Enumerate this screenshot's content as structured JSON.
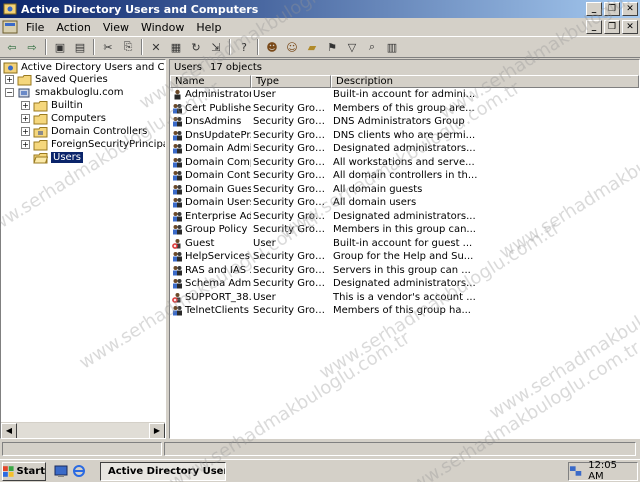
{
  "window": {
    "title": "Active Directory Users and Computers"
  },
  "menu": [
    "File",
    "Action",
    "View",
    "Window",
    "Help"
  ],
  "tree": {
    "root": "Active Directory Users and Computers",
    "saved_queries": "Saved Queries",
    "domain": "smakbuloglu.com",
    "children": [
      "Builtin",
      "Computers",
      "Domain Controllers",
      "ForeignSecurityPrincipals",
      "Users"
    ]
  },
  "pane": {
    "title": "Users",
    "count": "17 objects"
  },
  "columns": [
    "Name",
    "Type",
    "Description"
  ],
  "rows": [
    {
      "name": "Administrator",
      "type": "User",
      "desc": "Built-in account for admini...",
      "kind": "user"
    },
    {
      "name": "Cert Publishers",
      "type": "Security Group ...",
      "desc": "Members of this group are...",
      "kind": "group"
    },
    {
      "name": "DnsAdmins",
      "type": "Security Group ...",
      "desc": "DNS Administrators Group",
      "kind": "group"
    },
    {
      "name": "DnsUpdatePr...",
      "type": "Security Group ...",
      "desc": "DNS clients who are permi...",
      "kind": "group"
    },
    {
      "name": "Domain Admins",
      "type": "Security Group ...",
      "desc": "Designated administrators...",
      "kind": "group"
    },
    {
      "name": "Domain Comp...",
      "type": "Security Group ...",
      "desc": "All workstations and serve...",
      "kind": "group"
    },
    {
      "name": "Domain Contr...",
      "type": "Security Group ...",
      "desc": "All domain controllers in th...",
      "kind": "group"
    },
    {
      "name": "Domain Guests",
      "type": "Security Group ...",
      "desc": "All domain guests",
      "kind": "group"
    },
    {
      "name": "Domain Users",
      "type": "Security Group ...",
      "desc": "All domain users",
      "kind": "group"
    },
    {
      "name": "Enterprise Ad...",
      "type": "Security Group ...",
      "desc": "Designated administrators...",
      "kind": "group"
    },
    {
      "name": "Group Policy ...",
      "type": "Security Group ...",
      "desc": "Members in this group can...",
      "kind": "group"
    },
    {
      "name": "Guest",
      "type": "User",
      "desc": "Built-in account for guest ...",
      "kind": "disabled-user"
    },
    {
      "name": "HelpServices...",
      "type": "Security Group ...",
      "desc": "Group for the Help and Su...",
      "kind": "group"
    },
    {
      "name": "RAS and IAS ...",
      "type": "Security Group ...",
      "desc": "Servers in this group can ...",
      "kind": "group"
    },
    {
      "name": "Schema Admins",
      "type": "Security Group ...",
      "desc": "Designated administrators...",
      "kind": "group"
    },
    {
      "name": "SUPPORT_38...",
      "type": "User",
      "desc": "This is a vendor's account ...",
      "kind": "disabled-user"
    },
    {
      "name": "TelnetClients",
      "type": "Security Group ...",
      "desc": "Members of this group ha...",
      "kind": "group"
    }
  ],
  "taskbar": {
    "start": "Start",
    "task": "Active Directory User...",
    "clock": "12:05 AM"
  },
  "watermark": "www.serhadmakbuloglu.com.tr"
}
